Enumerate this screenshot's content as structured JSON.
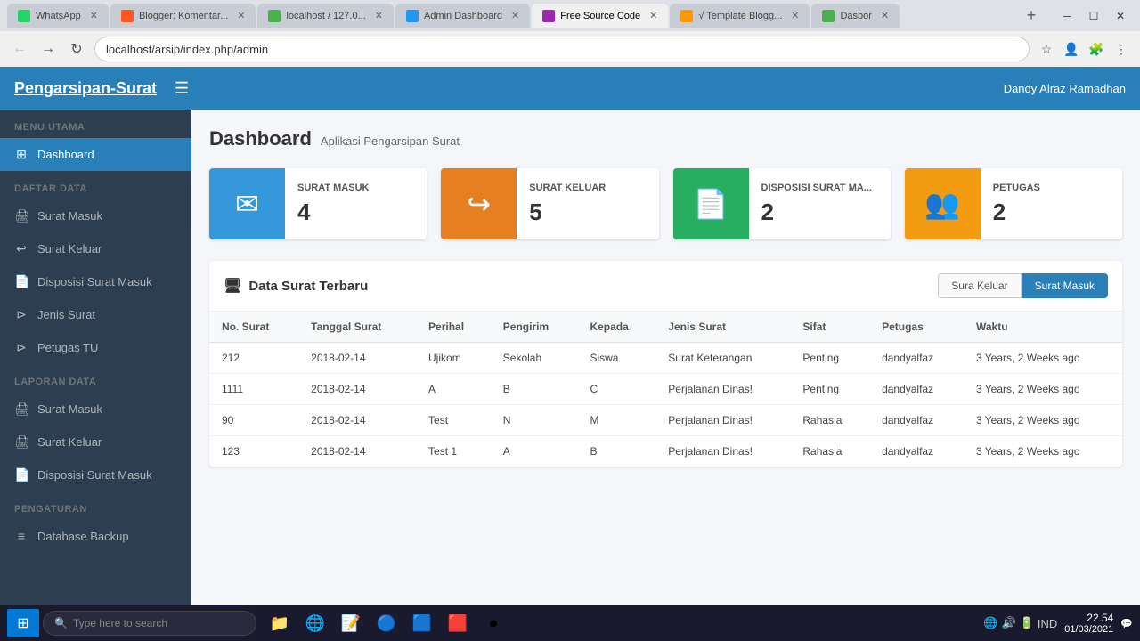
{
  "browser": {
    "tabs": [
      {
        "id": "whatsapp",
        "label": "WhatsApp",
        "favicon_color": "#25D366",
        "active": false
      },
      {
        "id": "blogger",
        "label": "Blogger: Komentar...",
        "favicon_color": "#FF5722",
        "active": false
      },
      {
        "id": "localhost",
        "label": "localhost / 127.0...",
        "favicon_color": "#4CAF50",
        "active": false
      },
      {
        "id": "admin-dashboard",
        "label": "Admin Dashboard",
        "favicon_color": "#2196F3",
        "active": false
      },
      {
        "id": "free-source-code",
        "label": "Free Source Code",
        "favicon_color": "#9C27B0",
        "active": true
      },
      {
        "id": "template-blog",
        "label": "√ Template Blogg...",
        "favicon_color": "#FF9800",
        "active": false
      },
      {
        "id": "dasbor",
        "label": "Dasbor",
        "favicon_color": "#4CAF50",
        "active": false
      }
    ],
    "address": "localhost/arsip/index.php/admin"
  },
  "topnav": {
    "brand": "Pengarsipan-Surat",
    "user": "Dandy Alraz Ramadhan"
  },
  "sidebar": {
    "sections": [
      {
        "label": "MENU UTAMA",
        "items": [
          {
            "id": "dashboard",
            "label": "Dashboard",
            "icon": "⊞",
            "active": true
          }
        ]
      },
      {
        "label": "DAFTAR DATA",
        "items": [
          {
            "id": "surat-masuk",
            "label": "Surat Masuk",
            "icon": "🖨",
            "active": false
          },
          {
            "id": "surat-keluar",
            "label": "Surat Keluar",
            "icon": "↩",
            "active": false
          },
          {
            "id": "disposisi-surat-masuk",
            "label": "Disposisi Surat Masuk",
            "icon": "📄",
            "active": false
          },
          {
            "id": "jenis-surat",
            "label": "Jenis Surat",
            "icon": "⊳",
            "active": false
          },
          {
            "id": "petugas-tu",
            "label": "Petugas TU",
            "icon": "⊳",
            "active": false
          }
        ]
      },
      {
        "label": "LAPORAN DATA",
        "items": [
          {
            "id": "laporan-surat-masuk",
            "label": "Surat Masuk",
            "icon": "🖨",
            "active": false
          },
          {
            "id": "laporan-surat-keluar",
            "label": "Surat Keluar",
            "icon": "🖨",
            "active": false
          },
          {
            "id": "laporan-disposisi",
            "label": "Disposisi Surat Masuk",
            "icon": "📄",
            "active": false
          }
        ]
      },
      {
        "label": "PENGATURAN",
        "items": [
          {
            "id": "database-backup",
            "label": "Database Backup",
            "icon": "≡",
            "active": false
          }
        ]
      }
    ]
  },
  "dashboard": {
    "title": "Dashboard",
    "subtitle": "Aplikasi Pengarsipan Surat",
    "stat_cards": [
      {
        "id": "surat-masuk",
        "label": "SURAT MASUK",
        "value": "4",
        "bg_color": "#3498db",
        "icon": "✉"
      },
      {
        "id": "surat-keluar",
        "label": "SURAT KELUAR",
        "value": "5",
        "bg_color": "#e67e22",
        "icon": "↪"
      },
      {
        "id": "disposisi",
        "label": "DISPOSISI SURAT MA...",
        "value": "2",
        "bg_color": "#27ae60",
        "icon": "📄"
      },
      {
        "id": "petugas",
        "label": "PETUGAS",
        "value": "2",
        "bg_color": "#f39c12",
        "icon": "👥"
      }
    ],
    "data_section": {
      "title": "Data Surat Terbaru",
      "tabs": [
        {
          "id": "sura-keluar",
          "label": "Sura Keluar",
          "active": false
        },
        {
          "id": "surat-masuk",
          "label": "Surat Masuk",
          "active": true
        }
      ],
      "columns": [
        "No. Surat",
        "Tanggal Surat",
        "Perihal",
        "Pengirim",
        "Kepada",
        "Jenis Surat",
        "Sifat",
        "Petugas",
        "Waktu"
      ],
      "rows": [
        {
          "no_surat": "212",
          "tanggal": "2018-02-14",
          "perihal": "Ujikom",
          "pengirim": "Sekolah",
          "kepada": "Siswa",
          "jenis": "Surat Keterangan",
          "sifat": "Penting",
          "petugas": "dandyalfaz",
          "waktu": "3 Years, 2 Weeks ago"
        },
        {
          "no_surat": "1111",
          "tanggal": "2018-02-14",
          "perihal": "A",
          "pengirim": "B",
          "kepada": "C",
          "jenis": "Perjalanan Dinas!",
          "sifat": "Penting",
          "petugas": "dandyalfaz",
          "waktu": "3 Years, 2 Weeks ago"
        },
        {
          "no_surat": "90",
          "tanggal": "2018-02-14",
          "perihal": "Test",
          "pengirim": "N",
          "kepada": "M",
          "jenis": "Perjalanan Dinas!",
          "sifat": "Rahasia",
          "petugas": "dandyalfaz",
          "waktu": "3 Years, 2 Weeks ago"
        },
        {
          "no_surat": "123",
          "tanggal": "2018-02-14",
          "perihal": "Test 1",
          "pengirim": "A",
          "kepada": "B",
          "jenis": "Perjalanan Dinas!",
          "sifat": "Rahasia",
          "petugas": "dandyalfaz",
          "waktu": "3 Years, 2 Weeks ago"
        }
      ]
    }
  },
  "taskbar": {
    "search_placeholder": "Type here to search",
    "time": "22.54",
    "date": "01/03/2021",
    "lang": "IND",
    "apps": [
      "📁",
      "🌐",
      "📝",
      "🔵",
      "🟦",
      "🟥",
      "⏺"
    ]
  }
}
